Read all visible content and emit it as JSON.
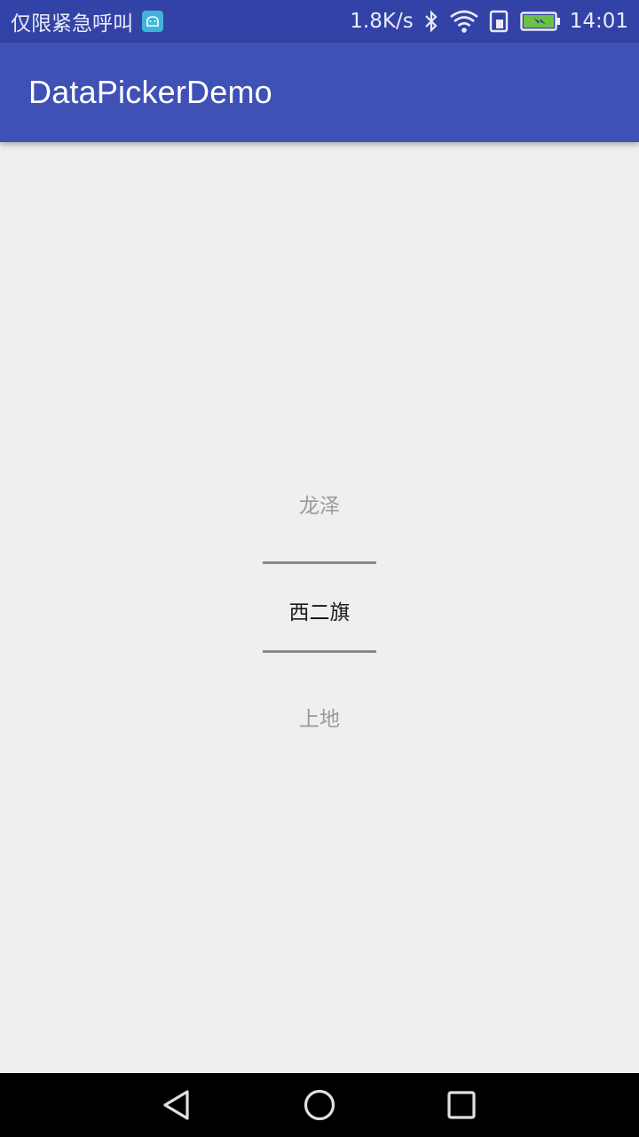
{
  "status_bar": {
    "carrier": "仅限紧急呼叫",
    "speed": "1.8K/s",
    "time": "14:01",
    "icons": [
      "android-notification-icon",
      "bluetooth-icon",
      "wifi-icon",
      "sim-icon",
      "battery-charging-icon"
    ]
  },
  "app_bar": {
    "title": "DataPickerDemo"
  },
  "picker": {
    "items": [
      "龙泽",
      "西二旗",
      "上地"
    ],
    "selected": "西二旗"
  },
  "nav_bar": {
    "buttons": [
      "back-icon",
      "home-icon",
      "recents-icon"
    ]
  },
  "colors": {
    "primary": "#3f51b5",
    "primary_dark": "#3342a6",
    "background": "#efefef",
    "divider": "#8a8a8a"
  }
}
